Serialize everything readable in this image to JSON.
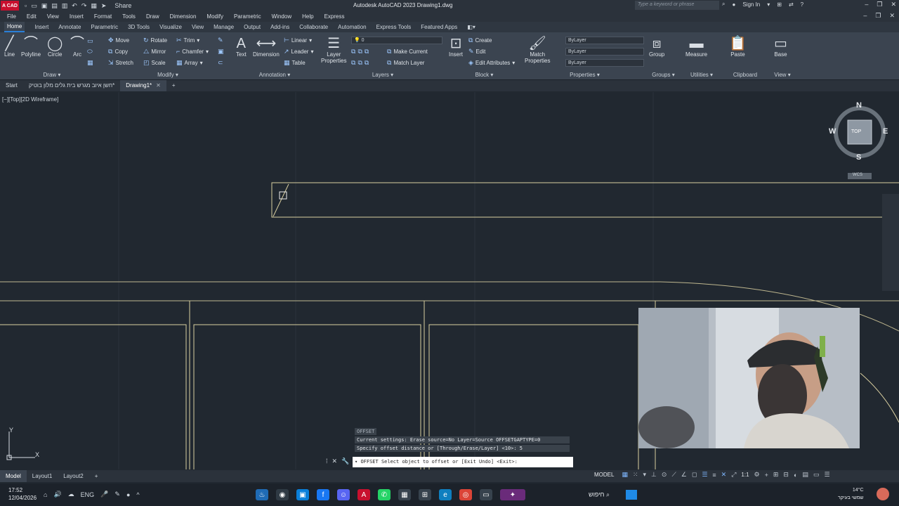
{
  "titlebar": {
    "logo": "A CAD",
    "share": "Share",
    "title": "Autodesk AutoCAD 2023   Drawing1.dwg",
    "search_placeholder": "Type a keyword or phrase",
    "sign_in": "Sign In"
  },
  "menubar": {
    "items": [
      "File",
      "Edit",
      "View",
      "Insert",
      "Format",
      "Tools",
      "Draw",
      "Dimension",
      "Modify",
      "Parametric",
      "Window",
      "Help",
      "Express"
    ]
  },
  "ribbon_tabs": {
    "items": [
      "Home",
      "Insert",
      "Annotate",
      "Parametric",
      "3D Tools",
      "Visualize",
      "View",
      "Manage",
      "Output",
      "Add-ins",
      "Collaborate",
      "Automation",
      "Express Tools",
      "Featured Apps"
    ]
  },
  "ribbon": {
    "draw": {
      "title": "Draw",
      "line": "Line",
      "polyline": "Polyline",
      "circle": "Circle",
      "arc": "Arc"
    },
    "modify": {
      "title": "Modify",
      "move": "Move",
      "rotate": "Rotate",
      "trim": "Trim",
      "copy": "Copy",
      "mirror": "Mirror",
      "chamfer": "Chamfer",
      "stretch": "Stretch",
      "scale": "Scale",
      "array": "Array"
    },
    "annotation": {
      "title": "Annotation",
      "text": "Text",
      "dimension": "Dimension",
      "linear": "Linear",
      "leader": "Leader",
      "table": "Table"
    },
    "layers": {
      "title": "Layers",
      "layer_properties_1": "Layer",
      "layer_properties_2": "Properties",
      "make_current": "Make Current",
      "match_layer": "Match Layer",
      "current_layer": "0"
    },
    "block": {
      "title": "Block",
      "insert": "Insert",
      "create": "Create",
      "edit": "Edit",
      "edit_attributes": "Edit Attributes"
    },
    "properties": {
      "title": "Properties",
      "match_1": "Match",
      "match_2": "Properties",
      "color": "ByLayer",
      "linetype": "ByLayer",
      "lineweight": "ByLayer"
    },
    "groups": {
      "title": "Groups",
      "group": "Group"
    },
    "utilities": {
      "title": "Utilities",
      "measure": "Measure"
    },
    "clipboard": {
      "title": "Clipboard",
      "paste": "Paste"
    },
    "view": {
      "title": "View",
      "base": "Base"
    }
  },
  "filetabs": {
    "start": "Start",
    "file1": "חשן איוב מגרש בית גלים מלון בוטיק*",
    "drawing1": "Drawing1*"
  },
  "viewport": {
    "label": "[−][Top][2D Wireframe]",
    "ucs_y": "Y",
    "ucs_x": "X"
  },
  "viewcube": {
    "n": "N",
    "s": "S",
    "e": "E",
    "w": "W",
    "top": "TOP",
    "wcs": "WCS"
  },
  "command": {
    "name": "OFFSET",
    "line1": "Current settings: Erase source=No  Layer=Source  OFFSETGAPTYPE=0",
    "line2": "Specify offset distance or [Through/Erase/Layer] <10>: 5",
    "prompt": "OFFSET Select object to offset or [Exit Undo] <Exit>:"
  },
  "statusbar": {
    "model_tab": "Model",
    "layout1": "Layout1",
    "layout2": "Layout2",
    "model_label": "MODEL",
    "scale": "1:1"
  },
  "taskbar": {
    "time": "17:52",
    "date": "12/04/2026",
    "lang": "ENG",
    "search": "חיפוש",
    "temp": "14°C",
    "weather": "שמשי בעיקר"
  },
  "colors": {
    "accent": "#2a7fd8",
    "canvas": "#212830",
    "ribbon": "#3b4450",
    "drawing_lines": "#d9cfa0"
  }
}
